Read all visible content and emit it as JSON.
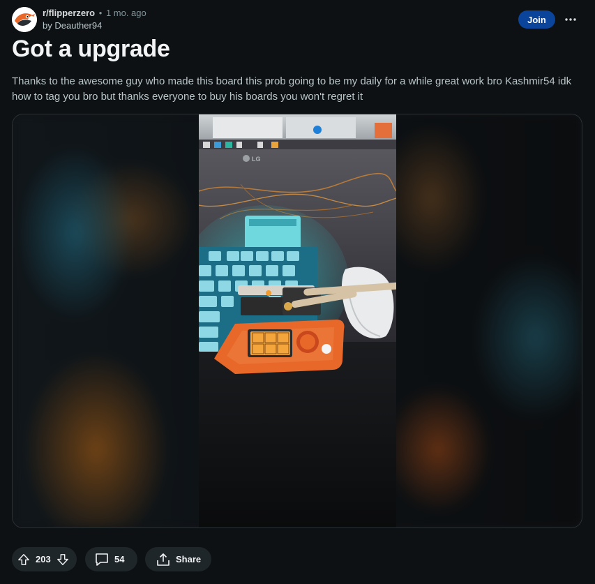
{
  "post": {
    "subreddit": "r/flipperzero",
    "separator": "•",
    "age": "1 mo. ago",
    "by_prefix": "by",
    "author": "Deauther94",
    "title": "Got a upgrade",
    "body": "Thanks to the awesome guy who made this board this prob going to be my daily for a while great work bro Kashmir54 idk how to tag you bro but thanks everyone to buy his boards you won't regret it",
    "join_label": "Join"
  },
  "image": {
    "monitor_brand": "LG"
  },
  "actions": {
    "score": "203",
    "comments": "54",
    "share_label": "Share"
  },
  "icons": {
    "avatar": "dolphin-avatar-icon",
    "more": "more-dots-icon",
    "upvote": "upvote-arrow-icon",
    "downvote": "downvote-arrow-icon",
    "comment": "comment-bubble-icon",
    "share": "share-icon"
  },
  "colors": {
    "background": "#0e1113",
    "join_button": "#0a449b",
    "pill": "#1f2629",
    "flipper_orange": "#e8682a"
  }
}
